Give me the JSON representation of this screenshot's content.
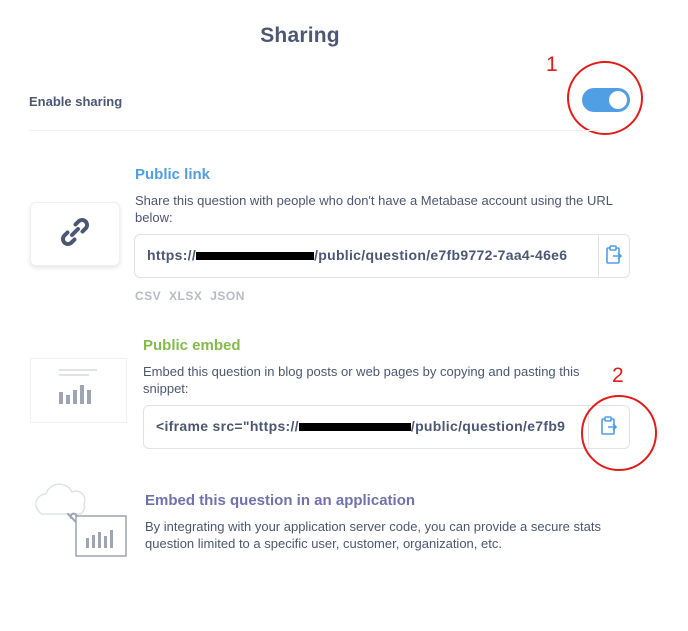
{
  "title": "Sharing",
  "enable_sharing": {
    "label": "Enable sharing",
    "enabled": true
  },
  "public_link": {
    "title": "Public link",
    "description": "Share this question with people who don't have a Metabase account using the URL below:",
    "url_prefix": "https://",
    "url_suffix": "/public/question/e7fb9772-7aa4-46e6",
    "formats": [
      "CSV",
      "XLSX",
      "JSON"
    ]
  },
  "public_embed": {
    "title": "Public embed",
    "description": "Embed this question in blog posts or web pages by copying and pasting this snippet:",
    "code_prefix": "<iframe   src=\"https://",
    "code_suffix": "/public/question/e7fb9"
  },
  "app_embed": {
    "title": "Embed this question in an application",
    "description": "By integrating with your application server code, you can provide a secure stats question limited to a specific user, customer, organization, etc."
  },
  "annotations": [
    "1",
    "2"
  ],
  "colors": {
    "brand": "#509ee3",
    "public_link_title": "#509ee3",
    "public_embed_title": "#84bb4c",
    "app_embed_title": "#7172ad",
    "annotation": "#e21b1b"
  }
}
